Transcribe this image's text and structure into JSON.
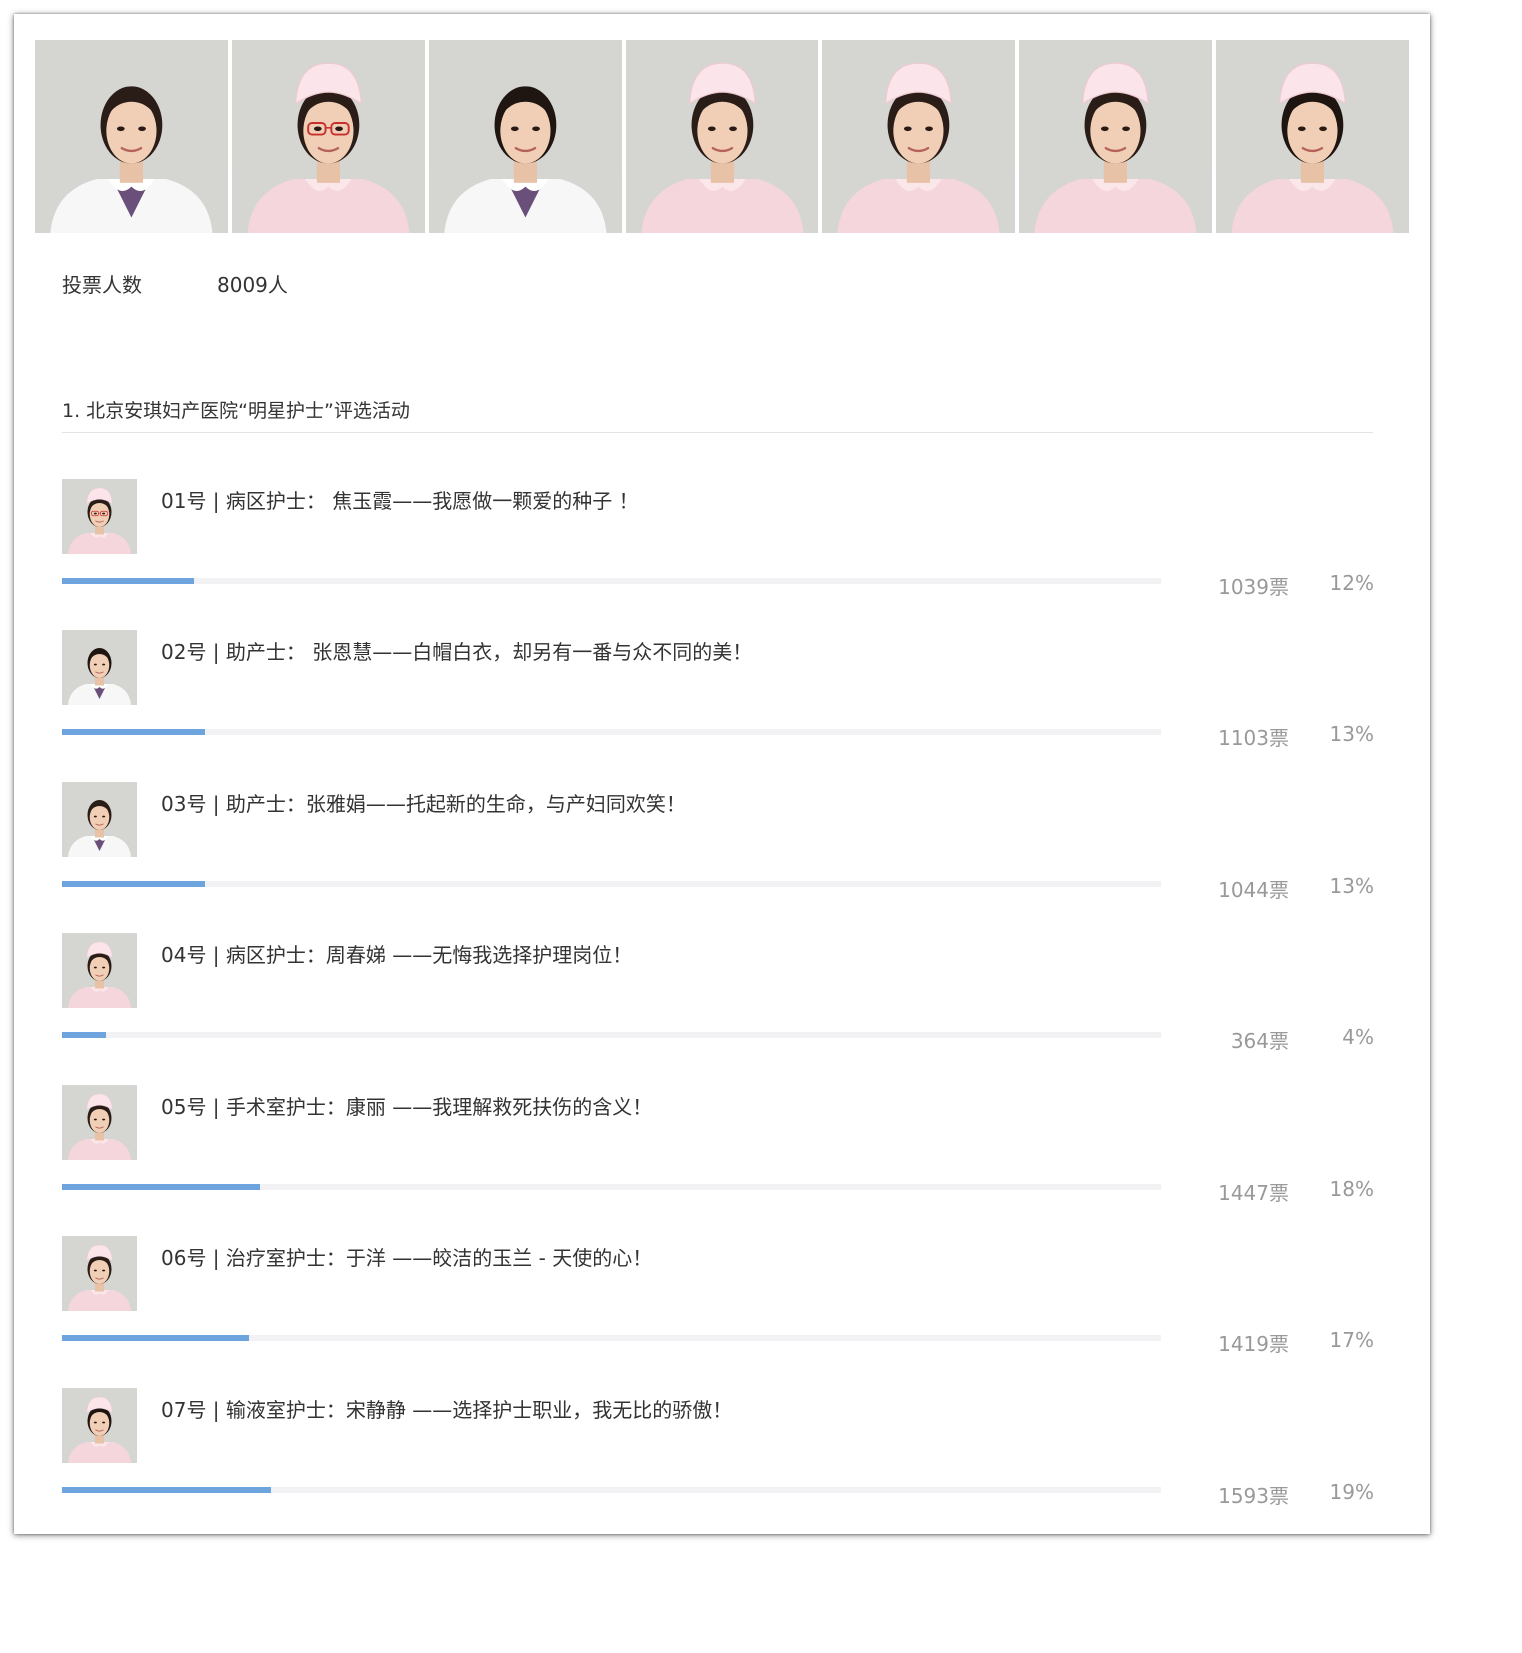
{
  "voters": {
    "label": "投票人数",
    "value": "8009人"
  },
  "question": {
    "title": "1. 北京安琪妇产医院“明星护士”评选活动"
  },
  "options": [
    {
      "label": "01号 | 病区护士： 焦玉霞——我愿做一颗爱的种子 ！",
      "votes": "1039票",
      "percent": "12%",
      "share": 0.12
    },
    {
      "label": "02号 | 助产士： 张恩慧——白帽白衣，却另有一番与众不同的美！",
      "votes": "1103票",
      "percent": "13%",
      "share": 0.13
    },
    {
      "label": "03号 | 助产士：张雅娟——托起新的生命，与产妇同欢笑！",
      "votes": "1044票",
      "percent": "13%",
      "share": 0.13
    },
    {
      "label": "04号 | 病区护士：周春娣 ——无悔我选择护理岗位！",
      "votes": "364票",
      "percent": "4%",
      "share": 0.04
    },
    {
      "label": "05号 | 手术室护士：康丽 ——我理解救死扶伤的含义！",
      "votes": "1447票",
      "percent": "18%",
      "share": 0.18
    },
    {
      "label": "06号 | 治疗室护士：于洋 ——皎洁的玉兰 - 天使的心！",
      "votes": "1419票",
      "percent": "17%",
      "share": 0.17
    },
    {
      "label": "07号 | 输液室护士：宋静静 ——选择护士职业，我无比的骄傲！",
      "votes": "1593票",
      "percent": "19%",
      "share": 0.19
    }
  ],
  "colors": {
    "bar_fill": "#6ea4de",
    "bar_track": "#f2f2f4",
    "muted_text": "#999999"
  }
}
